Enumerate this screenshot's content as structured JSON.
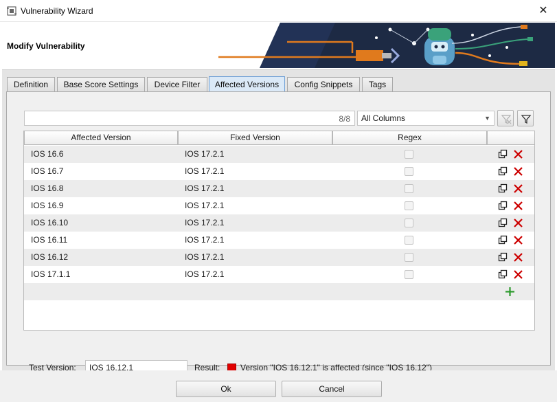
{
  "window": {
    "title": "Vulnerability Wizard",
    "close_glyph": "✕"
  },
  "header": {
    "heading": "Modify Vulnerability"
  },
  "tabs": [
    {
      "label": "Definition",
      "active": false
    },
    {
      "label": "Base Score Settings",
      "active": false
    },
    {
      "label": "Device Filter",
      "active": false
    },
    {
      "label": "Affected Versions",
      "active": true
    },
    {
      "label": "Config Snippets",
      "active": false
    },
    {
      "label": "Tags",
      "active": false
    }
  ],
  "filter": {
    "value": "",
    "count": "8/8",
    "column_option": "All Columns",
    "clear_filter_icon": "filter-clear-icon",
    "filter_icon": "filter-icon"
  },
  "table": {
    "columns": [
      "Affected Version",
      "Fixed Version",
      "Regex",
      ""
    ],
    "rows": [
      {
        "affected": "IOS 16.6",
        "fixed": "IOS 17.2.1",
        "regex": false
      },
      {
        "affected": "IOS 16.7",
        "fixed": "IOS 17.2.1",
        "regex": false
      },
      {
        "affected": "IOS 16.8",
        "fixed": "IOS 17.2.1",
        "regex": false
      },
      {
        "affected": "IOS 16.9",
        "fixed": "IOS 17.2.1",
        "regex": false
      },
      {
        "affected": "IOS 16.10",
        "fixed": "IOS 17.2.1",
        "regex": false
      },
      {
        "affected": "IOS 16.11",
        "fixed": "IOS 17.2.1",
        "regex": false
      },
      {
        "affected": "IOS 16.12",
        "fixed": "IOS 17.2.1",
        "regex": false
      },
      {
        "affected": "IOS 17.1.1",
        "fixed": "IOS 17.2.1",
        "regex": false
      }
    ],
    "row_actions": [
      "copy-icon",
      "delete-icon"
    ],
    "add_icon": "plus-icon"
  },
  "test": {
    "label": "Test Version:",
    "value": "IOS 16.12.1",
    "result_label": "Result:",
    "result_color": "#e00000",
    "result_text": "Version \"IOS 16.12.1\" is affected (since \"IOS 16.12\")"
  },
  "buttons": {
    "ok": "Ok",
    "cancel": "Cancel"
  },
  "colors": {
    "accent": "#0a7fd6",
    "delete": "#cc0000",
    "add": "#2a9a2a",
    "banner_dark": "#1d2a44"
  }
}
